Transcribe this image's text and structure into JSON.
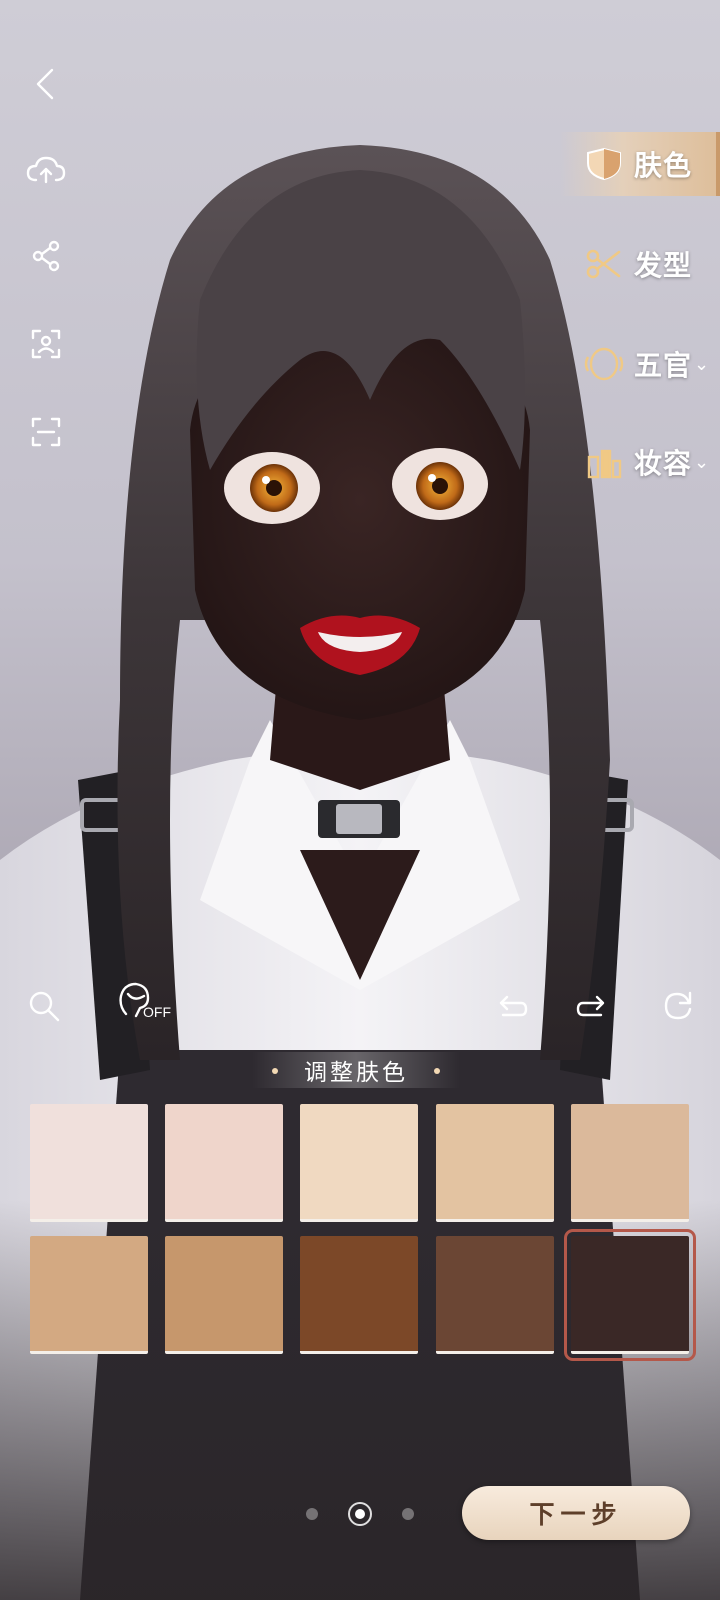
{
  "categories": [
    {
      "label": "肤色",
      "icon": "skin-tone-icon",
      "active": true,
      "has_dropdown": false
    },
    {
      "label": "发型",
      "icon": "scissors-icon",
      "active": false,
      "has_dropdown": false
    },
    {
      "label": "五官",
      "icon": "face-features-icon",
      "active": false,
      "has_dropdown": true
    },
    {
      "label": "妆容",
      "icon": "makeup-icon",
      "active": false,
      "has_dropdown": true
    }
  ],
  "toolbar": {
    "hair_toggle_state": "OFF"
  },
  "panel": {
    "title": "调整肤色"
  },
  "swatches": {
    "selected_index": 9,
    "colors": [
      "#f0e0dc",
      "#efd5cb",
      "#f0d9c1",
      "#e3c3a1",
      "#dbb99b",
      "#d3a982",
      "#c6976c",
      "#7c4828",
      "#6b4634",
      "#3a2826"
    ]
  },
  "pager": {
    "count": 3,
    "current": 1
  },
  "next_button": {
    "label": "下一步"
  },
  "colors": {
    "accent": "#c99a6a",
    "button_text": "#5e3f2a",
    "selection": "#b4584a"
  }
}
